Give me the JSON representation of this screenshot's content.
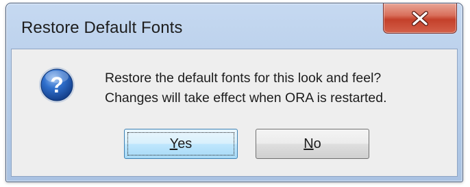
{
  "dialog": {
    "title": "Restore Default Fonts",
    "message_lines": [
      "Restore the default fonts for this look and feel?",
      "Changes will take effect when ORA is restarted."
    ],
    "icon": "question-icon",
    "buttons": {
      "yes": {
        "mnemonic": "Y",
        "rest": "es"
      },
      "no": {
        "mnemonic": "N",
        "rest": "o"
      }
    }
  },
  "titlebar": {
    "close_icon": "close-icon"
  },
  "colors": {
    "close_button": "#c4402a",
    "icon_blue": "#1f5fb6",
    "client_bg": "#eeeeee",
    "frame": "#b6cde9"
  }
}
